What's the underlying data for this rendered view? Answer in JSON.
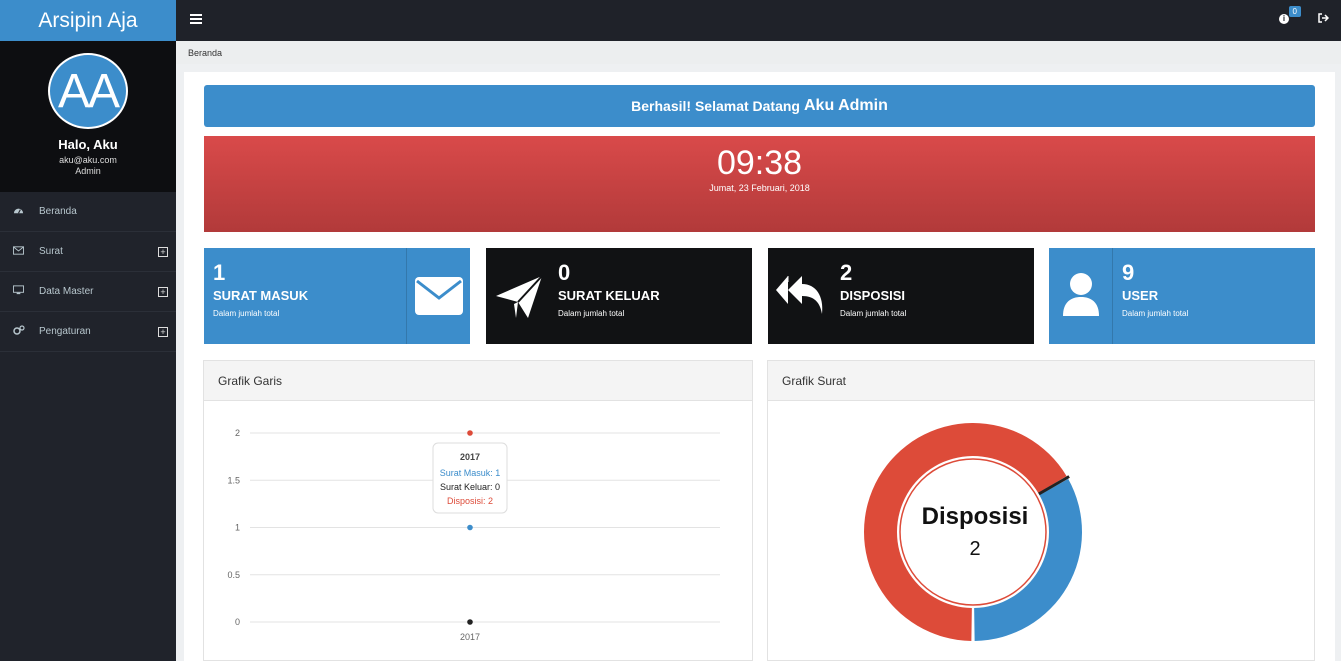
{
  "app": {
    "brand": "Arsipin Aja"
  },
  "profile": {
    "avatar_initials": "AA",
    "greeting": "Halo, Aku",
    "email": "aku@aku.com",
    "role": "Admin"
  },
  "sidebar": {
    "items": [
      {
        "label": "Beranda",
        "icon": "dashboard-icon",
        "expandable": false
      },
      {
        "label": "Surat",
        "icon": "envelope-icon",
        "expandable": true
      },
      {
        "label": "Data Master",
        "icon": "desktop-icon",
        "expandable": true
      },
      {
        "label": "Pengaturan",
        "icon": "cogs-icon",
        "expandable": true
      }
    ]
  },
  "topbar": {
    "notification_count": "0"
  },
  "breadcrumb": "Beranda",
  "alert": {
    "prefix": "Berhasil! Selamat Datang",
    "name": "Aku Admin"
  },
  "clock": {
    "time": "09:38",
    "date": "Jumat, 23 Februari, 2018"
  },
  "stats": [
    {
      "value": "1",
      "label": "SURAT MASUK",
      "sub": "Dalam jumlah total",
      "icon": "envelope-icon",
      "color": "#3c8dcb"
    },
    {
      "value": "0",
      "label": "SURAT KELUAR",
      "sub": "Dalam jumlah total",
      "icon": "paper-plane-icon",
      "color": "#111214"
    },
    {
      "value": "2",
      "label": "DISPOSISI",
      "sub": "Dalam jumlah total",
      "icon": "reply-all-icon",
      "color": "#111214"
    },
    {
      "value": "9",
      "label": "USER",
      "sub": "Dalam jumlah total",
      "icon": "user-icon",
      "color": "#3c8dcb"
    }
  ],
  "line_panel": {
    "title": "Grafik Garis"
  },
  "donut_panel": {
    "title": "Grafik Surat"
  },
  "chart_data": [
    {
      "type": "line",
      "x": [
        "2017"
      ],
      "ylim": [
        0,
        2
      ],
      "yticks": [
        "0",
        "0.5",
        "1",
        "1.5",
        "2"
      ],
      "series": [
        {
          "name": "Surat Masuk",
          "values": [
            1
          ],
          "color": "#3c8dcb"
        },
        {
          "name": "Surat Keluar",
          "values": [
            0
          ],
          "color": "#222222"
        },
        {
          "name": "Disposisi",
          "values": [
            2
          ],
          "color": "#dd4b39"
        }
      ],
      "tooltip": {
        "title": "2017",
        "lines": [
          "Surat Masuk: 1",
          "Surat Keluar: 0",
          "Disposisi: 2"
        ]
      },
      "grid": true
    },
    {
      "type": "pie",
      "categories": [
        "Surat Masuk",
        "Surat Keluar",
        "Disposisi"
      ],
      "values": [
        1,
        0,
        2
      ],
      "colors": [
        "#3c8dcb",
        "#222222",
        "#dd4b39"
      ],
      "center_label": "Disposisi",
      "center_value": "2"
    }
  ]
}
